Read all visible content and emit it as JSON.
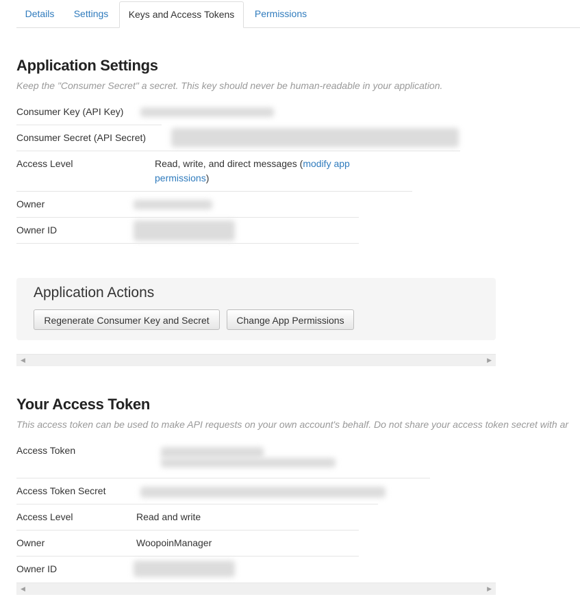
{
  "tabs": [
    {
      "label": "Details"
    },
    {
      "label": "Settings"
    },
    {
      "label": "Keys and Access Tokens"
    },
    {
      "label": "Permissions"
    }
  ],
  "app_settings": {
    "title": "Application Settings",
    "note": "Keep the \"Consumer Secret\" a secret. This key should never be human-readable in your application.",
    "rows": {
      "consumer_key": {
        "label": "Consumer Key (API Key)"
      },
      "consumer_secret": {
        "label": "Consumer Secret (API Secret)"
      },
      "access_level": {
        "label": "Access Level",
        "value_prefix": "Read, write, and direct messages (",
        "link1": "modify app",
        "link2": "permissions",
        "value_suffix": ")"
      },
      "owner": {
        "label": "Owner"
      },
      "owner_id": {
        "label": "Owner ID"
      }
    }
  },
  "app_actions": {
    "title": "Application Actions",
    "regenerate_button": "Regenerate Consumer Key and Secret",
    "change_permissions_button": "Change App Permissions"
  },
  "access_token": {
    "title": "Your Access Token",
    "note": "This access token can be used to make API requests on your own account's behalf. Do not share your access token secret with ar",
    "rows": {
      "token": {
        "label": "Access Token"
      },
      "secret": {
        "label": "Access Token Secret"
      },
      "access_level": {
        "label": "Access Level",
        "value": "Read and write"
      },
      "owner": {
        "label": "Owner",
        "value": "WoopoinManager"
      },
      "owner_id": {
        "label": "Owner ID"
      }
    }
  },
  "colors": {
    "link": "#2f7bbd",
    "note": "#999999",
    "panel": "#f5f5f5"
  }
}
